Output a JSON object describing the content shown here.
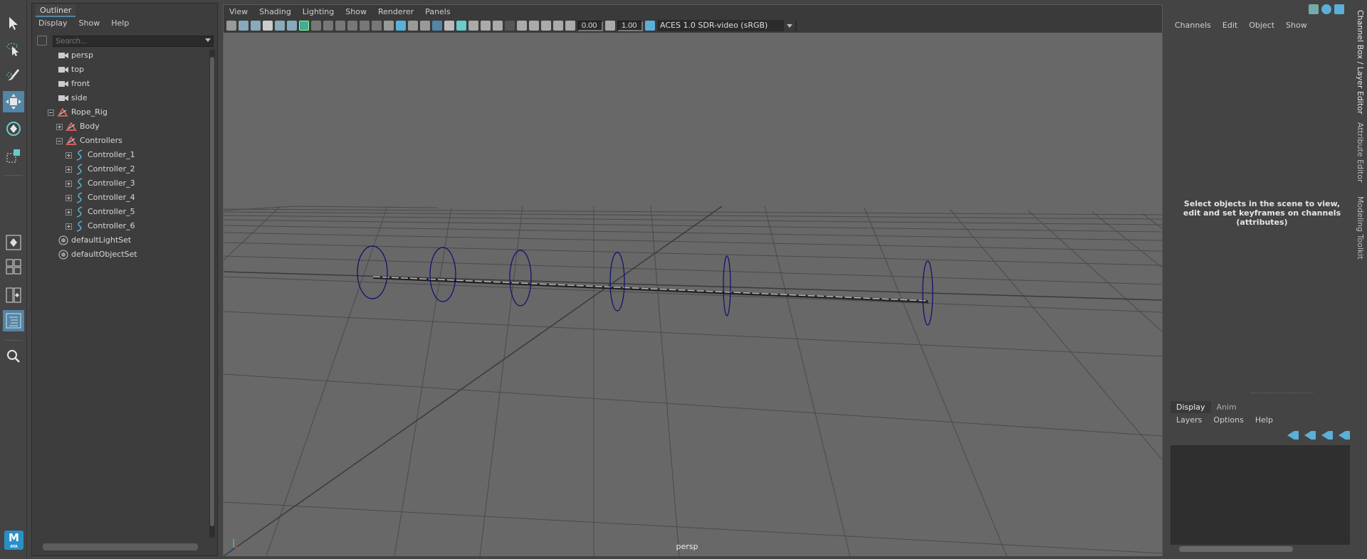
{
  "outliner": {
    "tab_label": "Outliner",
    "menu": [
      "Display",
      "Show",
      "Help"
    ],
    "search_placeholder": "Search...",
    "items": [
      {
        "label": "persp"
      },
      {
        "label": "top"
      },
      {
        "label": "front"
      },
      {
        "label": "side"
      },
      {
        "label": "Rope_Rig"
      },
      {
        "label": "Body"
      },
      {
        "label": "Controllers"
      },
      {
        "label": "Controller_1"
      },
      {
        "label": "Controller_2"
      },
      {
        "label": "Controller_3"
      },
      {
        "label": "Controller_4"
      },
      {
        "label": "Controller_5"
      },
      {
        "label": "Controller_6"
      },
      {
        "label": "defaultLightSet"
      },
      {
        "label": "defaultObjectSet"
      }
    ]
  },
  "viewport": {
    "menu": [
      "View",
      "Shading",
      "Lighting",
      "Show",
      "Renderer",
      "Panels"
    ],
    "exposure": "0.00",
    "gamma": "1.00",
    "color_space": "ACES 1.0 SDR-video (sRGB)",
    "camera_label": "persp"
  },
  "channel_box": {
    "menu": [
      "Channels",
      "Edit",
      "Object",
      "Show"
    ],
    "empty_message": "Select objects in the scene to view, edit and set keyframes on channels (attributes)",
    "tabs": [
      "Display",
      "Anim"
    ],
    "layer_menu": [
      "Layers",
      "Options",
      "Help"
    ]
  },
  "side_tabs": [
    "Channel Box / Layer Editor",
    "Attribute Editor",
    "Modeling Toolkit"
  ],
  "logo": {
    "letter": "M",
    "sub": "AYA"
  },
  "colors": {
    "accent": "#5285a6",
    "controller_curve": "#0c0c6e",
    "viewport_bg": "#686868"
  }
}
